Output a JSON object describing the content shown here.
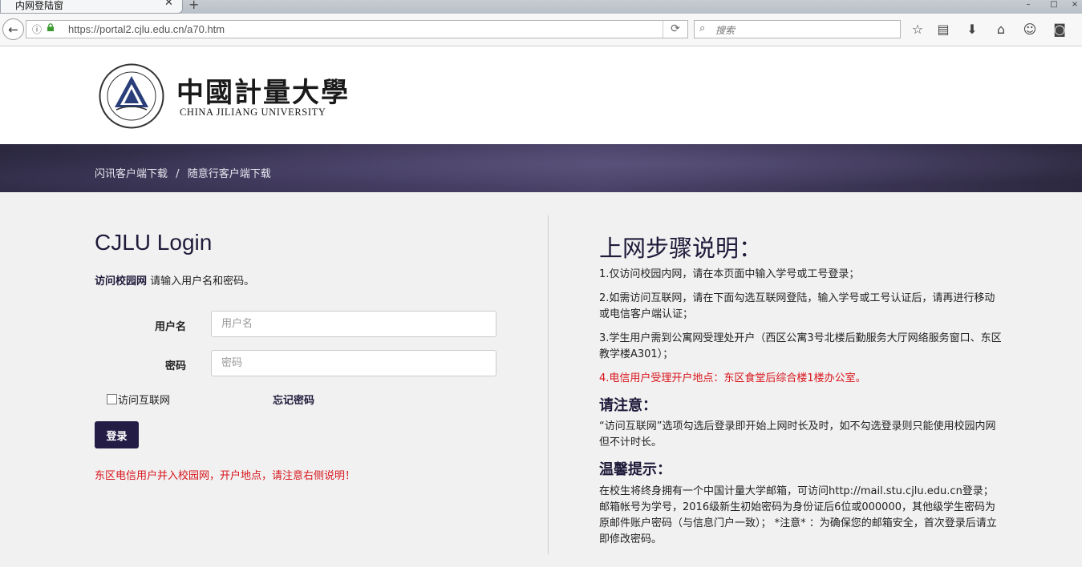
{
  "browser": {
    "tab_title": "内网登陆窗",
    "tab_close": "✕",
    "new_tab": "+",
    "url": "https://portal2.cjlu.edu.cn/a70.htm",
    "search_placeholder": "搜索"
  },
  "header": {
    "logo_cn": "中國計量大學",
    "logo_en": "CHINA JILIANG UNIVERSITY"
  },
  "banner": {
    "links": [
      "闪讯客户端下载",
      "随意行客户端下载"
    ],
    "separator": "/"
  },
  "login": {
    "title": "CJLU Login",
    "subtitle_bold": "访问校园网",
    "subtitle_rest": " 请输入用户名和密码。",
    "username_label": "用户名",
    "username_placeholder": "用户名",
    "password_label": "密码",
    "password_placeholder": "密码",
    "internet_checkbox_label": "访问互联网",
    "forgot_password": "忘记密码",
    "submit_label": "登录",
    "note": "东区电信用户并入校园网，开户地点，请注意右侧说明！"
  },
  "instructions": {
    "title": "上网步骤说明：",
    "steps": [
      "1.仅访问校园内网，请在本页面中输入学号或工号登录；",
      "2.如需访问互联网，请在下面勾选互联网登陆，输入学号或工号认证后，请再进行移动或电信客户端认证；",
      "3.学生用户需到公寓网受理处开户（西区公寓3号北楼后勤服务大厅网络服务窗口、东区教学楼A301）；",
      "4.电信用户受理开户地点：东区食堂后综合楼1楼办公室。"
    ],
    "notice_title": "请注意：",
    "notice_text": "“访问互联网”选项勾选后登录即开始上网时长及时，如不勾选登录则只能使用校园内网但不计时长。",
    "tips_title": "温馨提示：",
    "tips_text": "在校生将终身拥有一个中国计量大学邮箱，可访问http://mail.stu.cjlu.edu.cn登录； 邮箱帐号为学号，2016级新生初始密码为身份证后6位或000000，其他级学生密码为原邮件账户密码（与信息门户一致）； *注意* ：为确保您的邮箱安全，首次登录后请立即修改密码。"
  },
  "colors": {
    "brand_navy": "#231d46",
    "alert_red": "#d8141b"
  }
}
